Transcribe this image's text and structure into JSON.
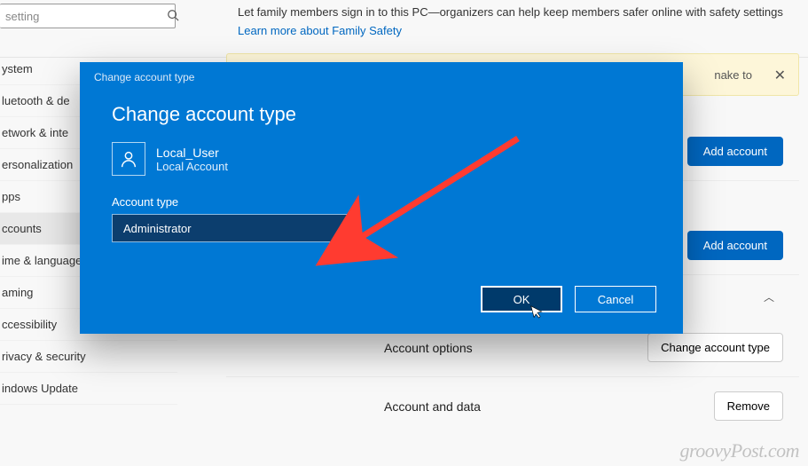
{
  "search": {
    "value": "setting"
  },
  "header": {
    "desc_prefix": "Let family members sign in to this PC—organizers can help keep members safer online with safety settings  ",
    "link": "Learn more about Family Safety"
  },
  "sidebar": {
    "items": [
      {
        "label": "ystem"
      },
      {
        "label": "luetooth & de"
      },
      {
        "label": "etwork & inte"
      },
      {
        "label": "ersonalization"
      },
      {
        "label": "pps"
      },
      {
        "label": "ccounts"
      },
      {
        "label": "ime & language"
      },
      {
        "label": "aming"
      },
      {
        "label": "ccessibility"
      },
      {
        "label": "rivacy & security"
      },
      {
        "label": "indows Update"
      }
    ],
    "active_index": 5
  },
  "notice": {
    "text_suffix": "nake to"
  },
  "rows": {
    "add1": {
      "label": "Add account"
    },
    "add2": {
      "label": "Add account"
    },
    "options": {
      "left": "Account options",
      "button": "Change account type"
    },
    "data": {
      "left": "Account and data",
      "button": "Remove"
    }
  },
  "dialog": {
    "titlebar": "Change account type",
    "heading": "Change account type",
    "user": {
      "name": "Local_User",
      "sub": "Local Account"
    },
    "field_label": "Account type",
    "selected": "Administrator",
    "ok": "OK",
    "cancel": "Cancel"
  },
  "watermark": "groovyPost.com"
}
